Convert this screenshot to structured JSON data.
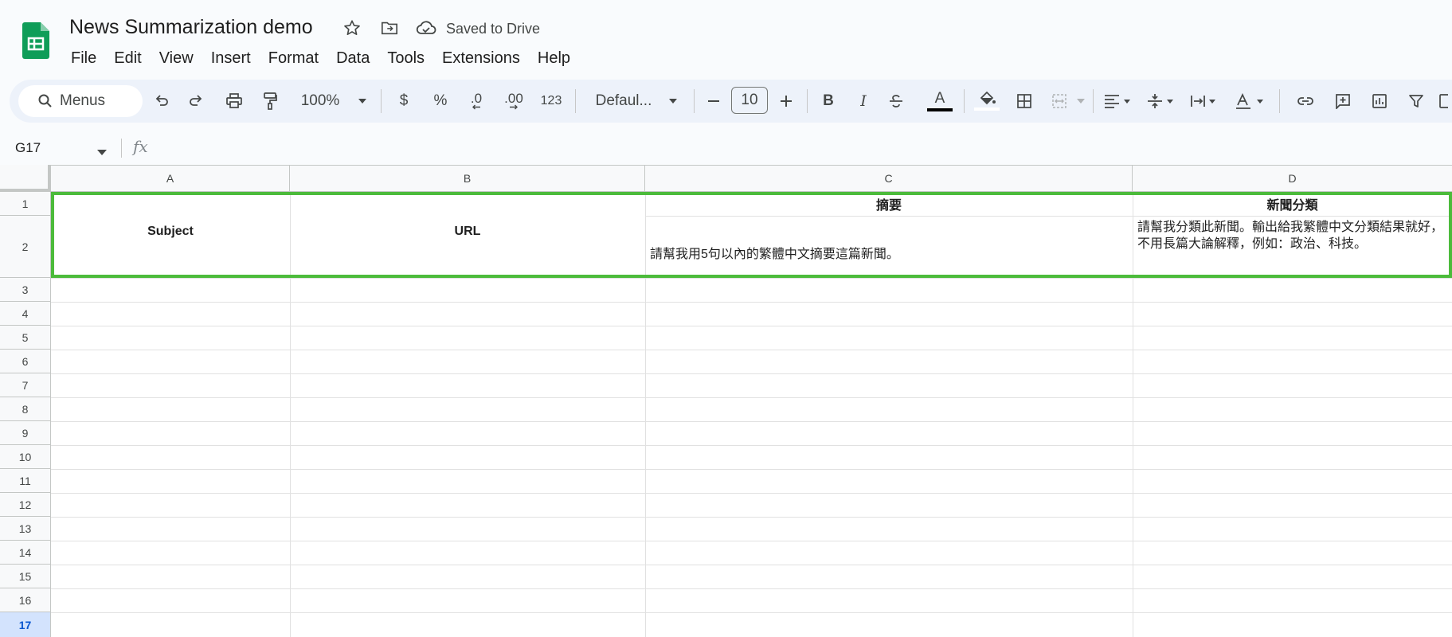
{
  "app": {
    "logo_icon": "google-sheets-icon",
    "brand_color": "#0f9d58"
  },
  "title": {
    "doc_name": "News Summarization demo",
    "saved_status": "Saved to Drive",
    "icons": [
      "star-icon",
      "move-folder-icon",
      "cloud-saved-icon"
    ]
  },
  "menu": [
    "File",
    "Edit",
    "View",
    "Insert",
    "Format",
    "Data",
    "Tools",
    "Extensions",
    "Help"
  ],
  "toolbar": {
    "search_label": "Menus",
    "zoom": "100%",
    "currency": "$",
    "percent": "%",
    "dec_decrease": ".0",
    "dec_increase": ".00",
    "number_format": "123",
    "font": "Defaul...",
    "font_size": "10",
    "bold": "B",
    "italic": "I",
    "text_color_letter": "A"
  },
  "formula_bar": {
    "name_box": "G17",
    "fx": "fx"
  },
  "columns": [
    "A",
    "B",
    "C",
    "D"
  ],
  "rows": [
    "1",
    "2",
    "3",
    "4",
    "5",
    "6",
    "7",
    "8",
    "9",
    "10",
    "11",
    "12",
    "13",
    "14",
    "15",
    "16",
    "17"
  ],
  "active_row": "17",
  "cells": {
    "A1_2": "Subject",
    "B1_2": "URL",
    "C1": "摘要",
    "C2": "請幫我用5句以內的繁體中文摘要這篇新聞。",
    "D1": "新聞分類",
    "D2": "請幫我分類此新聞。輸出給我繁體中文分類結果就好，不用長篇大論解釋，例如：政治、科技。"
  },
  "highlight_color": "#4cbb3b"
}
